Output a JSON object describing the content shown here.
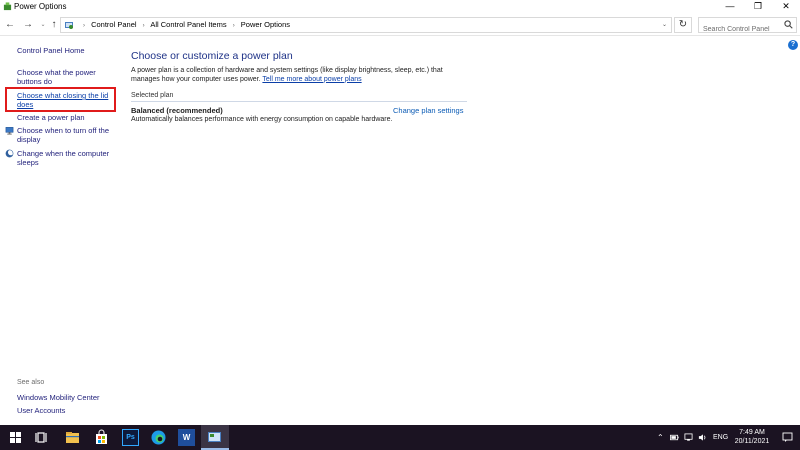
{
  "window": {
    "title": "Power Options",
    "controls": {
      "minimize": "—",
      "maximize": "❐",
      "close": "✕"
    }
  },
  "nav": {
    "back": "←",
    "forward": "→",
    "recent": "⌄",
    "up": "↑",
    "breadcrumbs": [
      "Control Panel",
      "All Control Panel Items",
      "Power Options"
    ],
    "separator": "›",
    "dropdown": "⌄",
    "refresh": "↻",
    "search_placeholder": "Search Control Panel"
  },
  "help": "?",
  "sidebar": {
    "home": "Control Panel Home",
    "items": [
      {
        "label": "Choose what the power buttons do",
        "icon": ""
      },
      {
        "label": "Choose what closing the lid does",
        "icon": "",
        "selected": true
      },
      {
        "label": "Create a power plan",
        "icon": ""
      },
      {
        "label": "Choose when to turn off the display",
        "icon": "monitor-icon"
      },
      {
        "label": "Change when the computer sleeps",
        "icon": "moon-icon"
      }
    ],
    "see_also_title": "See also",
    "see_also": [
      "Windows Mobility Center",
      "User Accounts"
    ]
  },
  "main": {
    "title": "Choose or customize a power plan",
    "description": "A power plan is a collection of hardware and system settings (like display brightness, sleep, etc.) that manages how your computer uses power.",
    "learn_more": "Tell me more about power plans",
    "selected_plan_header": "Selected plan",
    "plan": {
      "name": "Balanced (recommended)",
      "change_link": "Change plan settings",
      "description": "Automatically balances performance with energy consumption on capable hardware."
    }
  },
  "taskbar": {
    "apps": [
      "start-icon",
      "task-view-icon",
      "file-explorer-icon",
      "store-icon",
      "photoshop-icon",
      "edge-icon",
      "word-icon",
      "control-panel-icon"
    ],
    "ps_label": "Ps",
    "word_label": "W",
    "tray_chevron": "⌃",
    "language": "ENG",
    "time": "7:49 AM",
    "date": "20/11/2021"
  },
  "colors": {
    "link": "#1f1f7a",
    "heading": "#1e3287",
    "highlight_box": "#e01b1b",
    "taskbar": "#1b1322"
  }
}
